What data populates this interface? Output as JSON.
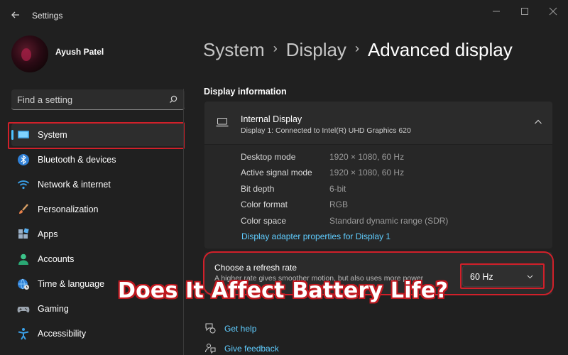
{
  "window": {
    "title": "Settings"
  },
  "user": {
    "name": "Ayush Patel"
  },
  "search": {
    "placeholder": "Find a setting"
  },
  "sidebar": {
    "items": [
      {
        "label": "System",
        "icon": "system-icon",
        "active": true
      },
      {
        "label": "Bluetooth & devices",
        "icon": "bluetooth-icon"
      },
      {
        "label": "Network & internet",
        "icon": "wifi-icon"
      },
      {
        "label": "Personalization",
        "icon": "brush-icon"
      },
      {
        "label": "Apps",
        "icon": "apps-icon"
      },
      {
        "label": "Accounts",
        "icon": "accounts-icon"
      },
      {
        "label": "Time & language",
        "icon": "globe-clock-icon"
      },
      {
        "label": "Gaming",
        "icon": "gamepad-icon"
      },
      {
        "label": "Accessibility",
        "icon": "accessibility-icon"
      }
    ]
  },
  "breadcrumb": {
    "items": [
      "System",
      "Display",
      "Advanced display"
    ]
  },
  "display_info": {
    "section_title": "Display information",
    "display_name": "Internal Display",
    "display_desc": "Display 1: Connected to Intel(R) UHD Graphics 620",
    "rows": [
      {
        "label": "Desktop mode",
        "value": "1920 × 1080, 60 Hz"
      },
      {
        "label": "Active signal mode",
        "value": "1920 × 1080, 60 Hz"
      },
      {
        "label": "Bit depth",
        "value": "6-bit"
      },
      {
        "label": "Color format",
        "value": "RGB"
      },
      {
        "label": "Color space",
        "value": "Standard dynamic range (SDR)"
      }
    ],
    "adapter_link": "Display adapter properties for Display 1"
  },
  "refresh_rate": {
    "title": "Choose a refresh rate",
    "description": "A higher rate gives smoother motion, but also uses more power",
    "selected": "60 Hz"
  },
  "help": {
    "get_help": "Get help",
    "give_feedback": "Give feedback"
  },
  "overlay_caption": "Does It Affect Battery Life?",
  "colors": {
    "accent": "#60cdff",
    "highlight": "#d1202a",
    "background": "#202020"
  }
}
